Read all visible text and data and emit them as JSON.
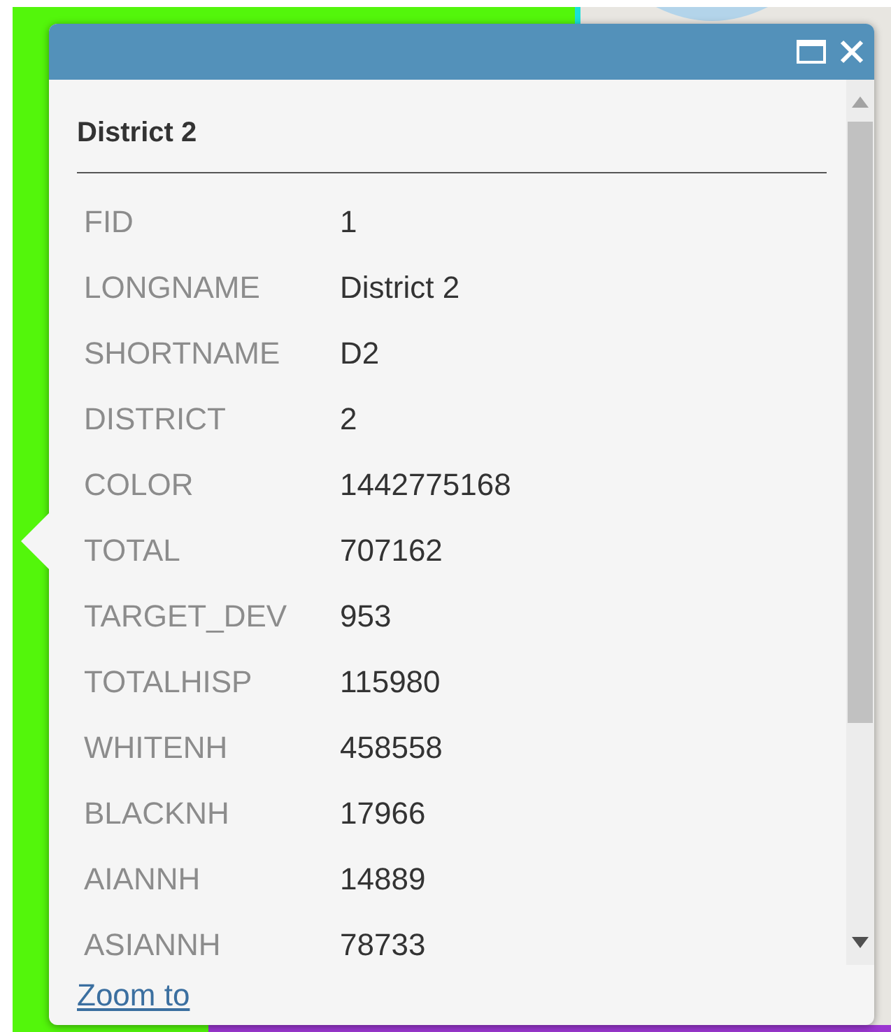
{
  "popup": {
    "title": "District 2",
    "fields": [
      {
        "label": "FID",
        "value": "1"
      },
      {
        "label": "LONGNAME",
        "value": "District 2"
      },
      {
        "label": "SHORTNAME",
        "value": "D2"
      },
      {
        "label": "DISTRICT",
        "value": "2"
      },
      {
        "label": "COLOR",
        "value": "1442775168"
      },
      {
        "label": "TOTAL",
        "value": "707162"
      },
      {
        "label": "TARGET_DEV",
        "value": "953"
      },
      {
        "label": "TOTALHISP",
        "value": "115980"
      },
      {
        "label": "WHITENH",
        "value": "458558"
      },
      {
        "label": "BLACKNH",
        "value": "17966"
      },
      {
        "label": "AIANNH",
        "value": "14889"
      },
      {
        "label": "ASIANNH",
        "value": "78733"
      }
    ],
    "link": "Zoom to"
  }
}
